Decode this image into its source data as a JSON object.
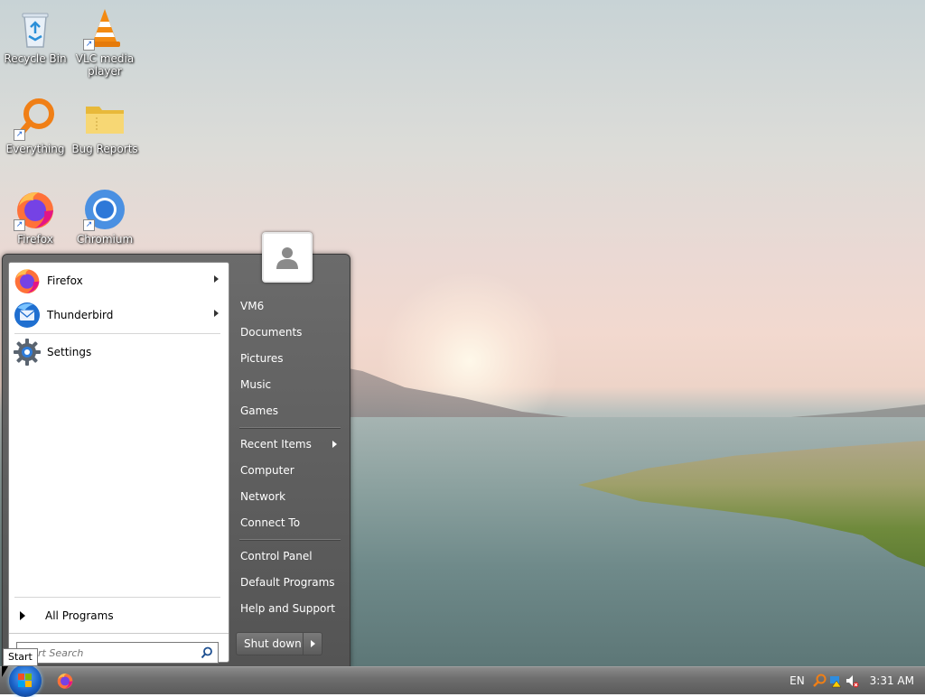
{
  "desktop": {
    "icons": [
      {
        "label": "Recycle Bin"
      },
      {
        "label": "VLC media player"
      },
      {
        "label": "Everything"
      },
      {
        "label": "Bug Reports"
      },
      {
        "label": "Firefox"
      },
      {
        "label": "Chromium"
      }
    ]
  },
  "start_menu": {
    "pinned": [
      {
        "label": "Firefox"
      },
      {
        "label": "Thunderbird"
      },
      {
        "label": "Settings"
      }
    ],
    "all_programs": "All Programs",
    "search": {
      "placeholder": "Start Search",
      "value": ""
    },
    "right": {
      "user": "VM6",
      "documents": "Documents",
      "pictures": "Pictures",
      "music": "Music",
      "games": "Games",
      "recent_items": "Recent Items",
      "computer": "Computer",
      "network": "Network",
      "connect_to": "Connect To",
      "control_panel": "Control Panel",
      "default_programs": "Default Programs",
      "help_support": "Help and Support",
      "shutdown": "Shut down"
    }
  },
  "taskbar": {
    "start_tooltip": "Start",
    "language": "EN",
    "clock": "3:31 AM"
  }
}
